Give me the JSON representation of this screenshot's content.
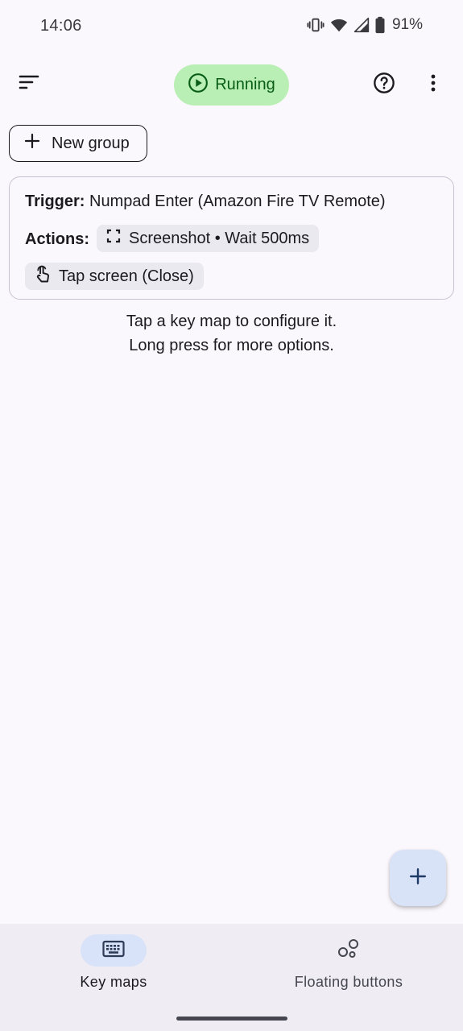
{
  "status_bar": {
    "time": "14:06",
    "battery": "91%",
    "icons": [
      "vibrate-icon",
      "wifi-icon",
      "cell-signal-icon",
      "battery-icon"
    ]
  },
  "top_bar": {
    "menu_icon": "sort-icon",
    "running_label": "Running",
    "running_icon": "play-circle-icon",
    "help_icon": "help-circle-icon",
    "more_icon": "more-vert-icon"
  },
  "new_group": {
    "label": "New group",
    "icon": "plus-icon"
  },
  "keymap": {
    "trigger_label": "Trigger:",
    "trigger_value": "Numpad Enter (Amazon Fire TV Remote)",
    "actions_label": "Actions:",
    "actions": [
      {
        "icon": "screenshot-icon",
        "label": "Screenshot • Wait 500ms"
      },
      {
        "icon": "touch-icon",
        "label": "Tap screen (Close)"
      }
    ]
  },
  "hint": {
    "line1": "Tap a key map to configure it.",
    "line2": "Long press for more options."
  },
  "fab": {
    "icon": "plus-icon"
  },
  "bottom_nav": {
    "items": [
      {
        "label": "Key maps",
        "icon": "keyboard-icon",
        "active": true
      },
      {
        "label": "Floating buttons",
        "icon": "bubbles-icon",
        "active": false
      }
    ]
  },
  "colors": {
    "background": "#fbf8fd",
    "running_chip": "#b9efb5",
    "running_text": "#0a5d16",
    "fab": "#d9e3f8",
    "nav_bar": "#efedf3",
    "nav_active": "#d8e2f9"
  }
}
